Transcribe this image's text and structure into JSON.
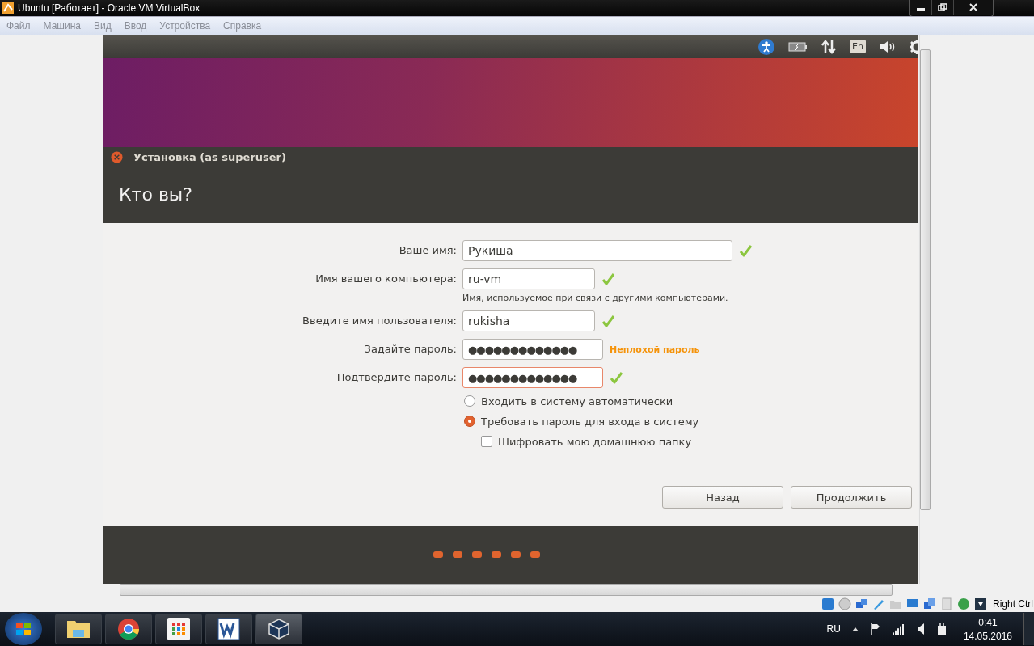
{
  "window": {
    "title": "Ubuntu [Работает] - Oracle VM VirtualBox"
  },
  "menu": [
    {
      "label": "Файл",
      "disabled": true
    },
    {
      "label": "Машина",
      "disabled": true
    },
    {
      "label": "Вид",
      "disabled": true
    },
    {
      "label": "Ввод",
      "disabled": true
    },
    {
      "label": "Устройства",
      "disabled": true
    },
    {
      "label": "Справка",
      "disabled": true
    }
  ],
  "guest_panel": {
    "keyboard_layout": "En"
  },
  "installer": {
    "title": "Установка (as superuser)",
    "heading": "Кто вы?",
    "fields": [
      {
        "kind": "name",
        "label": "Ваше имя:",
        "value": "Рукиша",
        "valid": true,
        "focused": false
      },
      {
        "kind": "text",
        "label": "Имя вашего компьютера:",
        "value": "ru-vm",
        "valid": true,
        "focused": false,
        "hint": "Имя, используемое при связи с другими компьютерами."
      },
      {
        "kind": "text",
        "label": "Введите имя пользователя:",
        "value": "rukisha",
        "valid": true,
        "focused": false
      },
      {
        "kind": "password",
        "label": "Задайте пароль:",
        "value": "●●●●●●●●●●●●●",
        "valid": false,
        "focused": false,
        "strength": "Неплохой пароль"
      },
      {
        "kind": "password",
        "label": "Подтвердите пароль:",
        "value": "●●●●●●●●●●●●●",
        "valid": true,
        "focused": true
      }
    ],
    "login_options": [
      {
        "label": "Входить в систему автоматически",
        "selected": false
      },
      {
        "label": "Требовать пароль для входа в систему",
        "selected": true
      }
    ],
    "encrypt": {
      "label": "Шифровать мою домашнюю папку",
      "checked": false
    },
    "buttons": [
      "Назад",
      "Продолжить"
    ]
  },
  "status_bar": {
    "host_key": "Right Ctrl"
  },
  "taskbar": {
    "language": "RU",
    "time": "0:41",
    "date": "14.05.2016"
  }
}
